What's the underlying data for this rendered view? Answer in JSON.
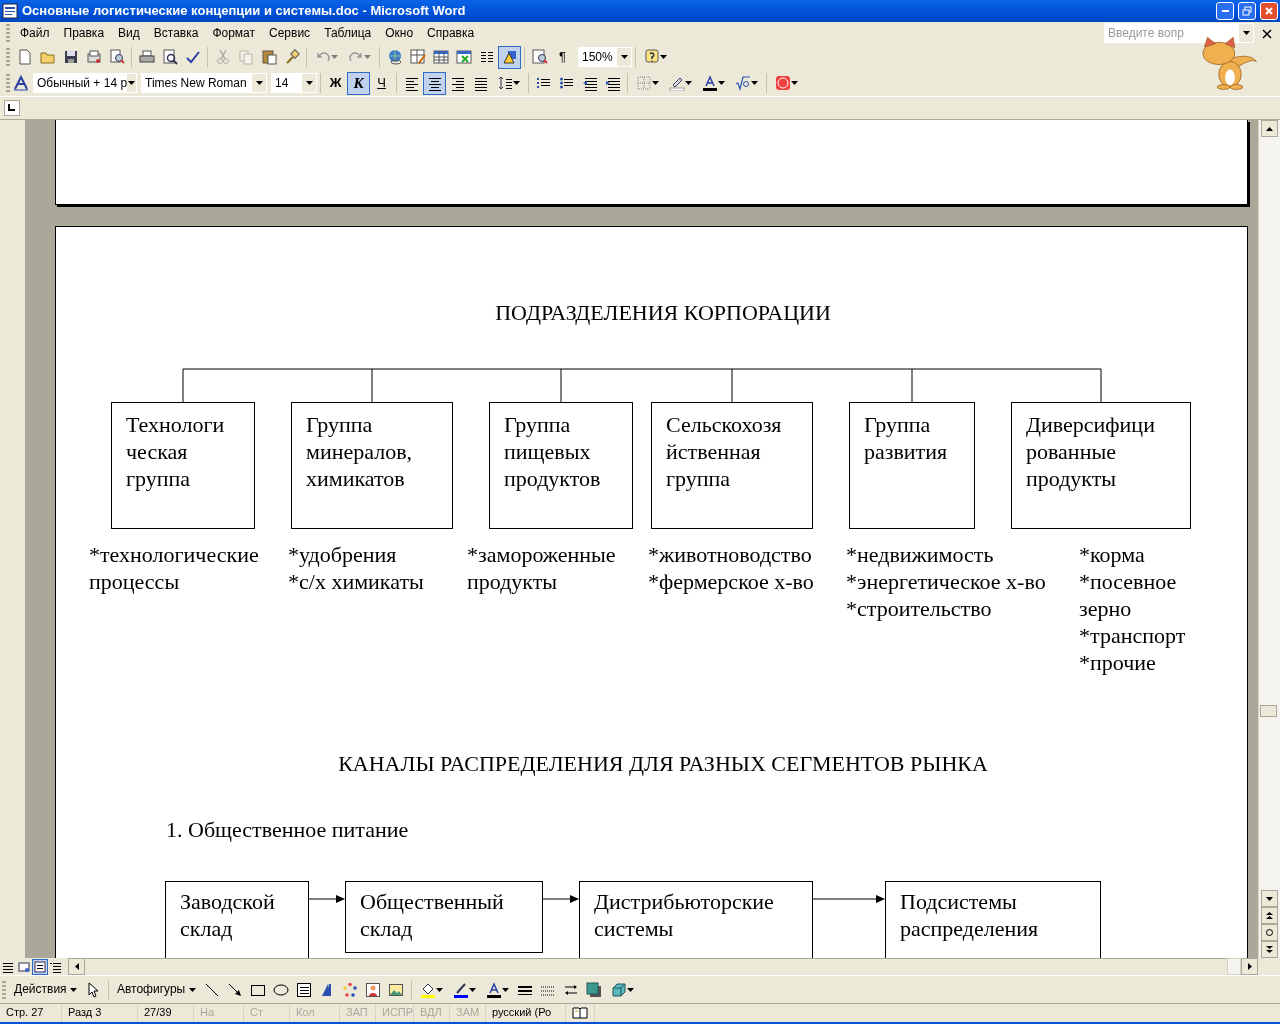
{
  "window": {
    "title": "Основные логистические концепции и системы.doc - Microsoft Word"
  },
  "menu": [
    "Файл",
    "Правка",
    "Вид",
    "Вставка",
    "Формат",
    "Сервис",
    "Таблица",
    "Окно",
    "Справка"
  ],
  "help_box": {
    "placeholder": "Введите вопр"
  },
  "standard_toolbar": {
    "buttons": [
      {
        "disabled": false,
        "pressed": false
      },
      {
        "disabled": false,
        "pressed": false
      },
      {
        "disabled": false,
        "pressed": false
      },
      {
        "disabled": false,
        "pressed": false
      },
      {
        "disabled": false,
        "pressed": false
      },
      {
        "disabled": false,
        "pressed": false
      },
      {
        "disabled": false,
        "pressed": false
      },
      {
        "disabled": false,
        "pressed": false
      },
      {
        "disabled": true,
        "pressed": false
      },
      {
        "disabled": true,
        "pressed": false
      },
      {
        "disabled": false,
        "pressed": false
      },
      {
        "disabled": false,
        "pressed": false
      },
      {
        "disabled": true,
        "pressed": false
      },
      {
        "disabled": true,
        "pressed": false
      },
      {
        "disabled": false,
        "pressed": false
      },
      {
        "disabled": false,
        "pressed": false
      },
      {
        "disabled": false,
        "pressed": false
      },
      {
        "disabled": false,
        "pressed": false
      },
      {
        "disabled": false,
        "pressed": false
      },
      {
        "disabled": false,
        "pressed": true
      },
      {
        "disabled": false,
        "pressed": false
      },
      {
        "disabled": false,
        "pressed": false,
        "label": "¶"
      }
    ],
    "zoom": "150%"
  },
  "formatting_toolbar": {
    "style": "Обычный + 14 р",
    "font": "Times New Roman",
    "size": "14",
    "buttons": [
      {
        "label": "Ж",
        "pressed": false
      },
      {
        "label": "К",
        "pressed": true
      },
      {
        "label": "Ч",
        "pressed": false
      },
      {
        "pressed": false
      },
      {
        "pressed": true
      },
      {
        "pressed": false
      },
      {
        "pressed": false
      },
      {
        "pressed": false
      },
      {
        "pressed": false
      },
      {
        "pressed": false
      },
      {
        "pressed": false
      },
      {
        "pressed": false
      },
      {
        "pressed": false
      },
      {
        "pressed": false
      },
      {
        "pressed": false
      },
      {
        "pressed": false
      },
      {
        "pressed": false
      }
    ]
  },
  "document": {
    "heading_1": "ПОДРАЗДЕЛЕНИЯ КОРПОРАЦИИ",
    "divisions": [
      {
        "name": "Технологи\nческая\nгруппа",
        "notes": [
          "*технологические\nпроцессы"
        ]
      },
      {
        "name": "Группа\nминералов,\nхимикатов",
        "notes": [
          "*удобрения",
          "*с/х химикаты"
        ]
      },
      {
        "name": "Группа\nпищевых\nпродуктов",
        "notes": [
          "*замороженные\nпродукты"
        ]
      },
      {
        "name": "Сельскохозя\nйственная\nгруппа",
        "notes": [
          "*животноводство",
          "*фермерское х-во"
        ]
      },
      {
        "name": "Группа\nразвития",
        "notes": [
          "*недвижимость",
          "*энергетическое х-во",
          "*строительство"
        ]
      },
      {
        "name": "Диверсифици\nрованные\nпродукты",
        "notes": [
          "*корма",
          "*посевное\nзерно",
          "*транспорт",
          "*прочие"
        ]
      }
    ],
    "heading_2": "КАНАЛЫ РАСПРЕДЕЛЕНИЯ ДЛЯ РАЗНЫХ СЕГМЕНТОВ РЫНКА",
    "section": "1. Общественное питание",
    "flow": [
      "Заводской\nсклад",
      "Общественный\nсклад",
      "Дистрибьюторские\nсистемы",
      "Подсистемы\nраспределения"
    ]
  },
  "view_buttons": [
    {
      "selected": false
    },
    {
      "selected": false
    },
    {
      "selected": true
    },
    {
      "selected": false
    }
  ],
  "drawing_toolbar": {
    "actions": "Действия",
    "autoshapes": "Автофигуры"
  },
  "status_bar": [
    {
      "text": "Стр. 27",
      "disabled": false
    },
    {
      "text": "Разд 3",
      "disabled": false
    },
    {
      "text": "27/39",
      "disabled": false
    },
    {
      "text": "На",
      "disabled": true
    },
    {
      "text": "Ст",
      "disabled": true
    },
    {
      "text": "Кол",
      "disabled": true
    },
    {
      "text": "ЗАП",
      "disabled": true
    },
    {
      "text": "ИСПР",
      "disabled": true
    },
    {
      "text": "ВДЛ",
      "disabled": true
    },
    {
      "text": "ЗАМ",
      "disabled": true
    },
    {
      "text": "русский (Ро",
      "disabled": false
    }
  ]
}
